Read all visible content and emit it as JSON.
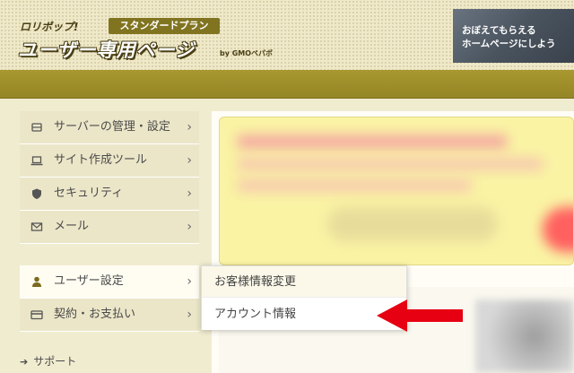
{
  "header": {
    "brand_small": "ロリポップ!",
    "plan_badge": "スタンダードプラン",
    "brand_title": "ユーザー専用ページ",
    "by_text": "by GMOペパボ",
    "banner": {
      "line1": "おぼえてもらえる",
      "line2": "ホームページにしよう"
    }
  },
  "sidebar": {
    "items": [
      {
        "label": "サーバーの管理・設定",
        "icon": "server-icon",
        "chevron": "›"
      },
      {
        "label": "サイト作成ツール",
        "icon": "laptop-icon",
        "chevron": "›"
      },
      {
        "label": "セキュリティ",
        "icon": "shield-icon",
        "chevron": "›"
      },
      {
        "label": "メール",
        "icon": "mail-icon",
        "chevron": "›"
      },
      {
        "label": "ユーザー設定",
        "icon": "user-icon",
        "chevron": "›"
      },
      {
        "label": "契約・お支払い",
        "icon": "credit-card-icon",
        "chevron": "›"
      }
    ],
    "support_label": "サポート"
  },
  "dropdown": {
    "items": [
      {
        "label": "お客様情報変更"
      },
      {
        "label": "アカウント情報"
      }
    ]
  },
  "colors": {
    "gold_bar": "#a99830",
    "arrow": "#e60012",
    "sidebar_bg": "#ebe6c8",
    "notice_bg": "#faf3a4"
  }
}
